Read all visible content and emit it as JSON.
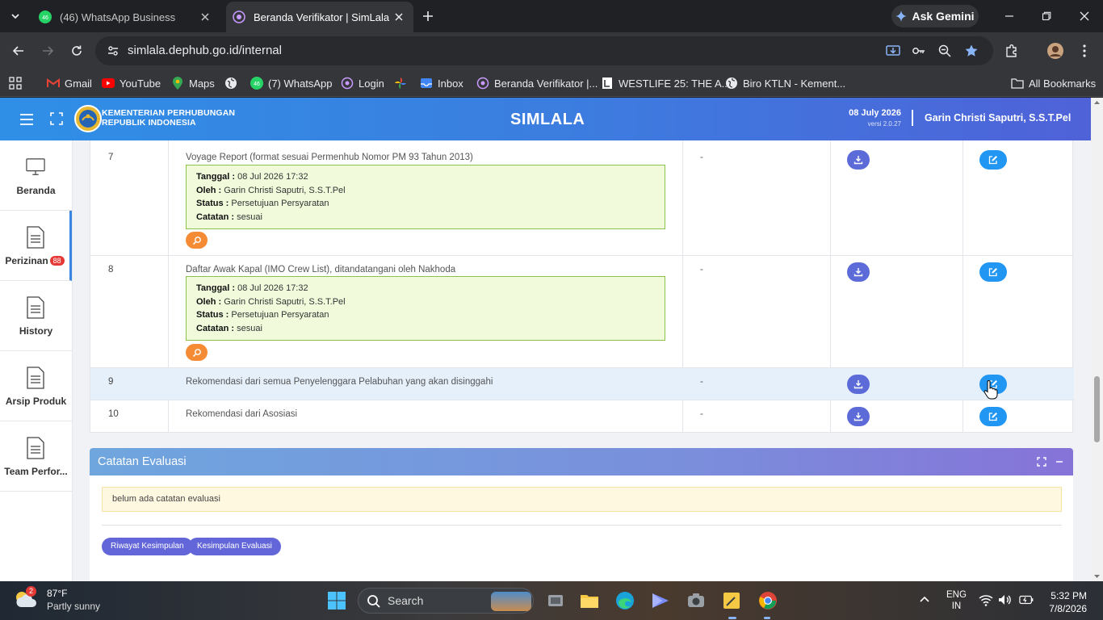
{
  "browser": {
    "tabs": [
      {
        "label": "(46) WhatsApp Business",
        "active": false
      },
      {
        "label": "Beranda Verifikator | SimLala",
        "active": true
      }
    ],
    "gemini_label": "Ask Gemini",
    "url": "simlala.dephub.go.id/internal",
    "bookmarks": [
      {
        "label": "Gmail",
        "icon": "gmail-icon"
      },
      {
        "label": "YouTube",
        "icon": "youtube-icon"
      },
      {
        "label": "Maps",
        "icon": "maps-icon"
      },
      {
        "label": "",
        "icon": "globe-icon"
      },
      {
        "label": "(7) WhatsApp",
        "icon": "whatsapp-icon"
      },
      {
        "label": "Login",
        "icon": "site-icon"
      },
      {
        "label": "",
        "icon": "photos-icon"
      },
      {
        "label": "Inbox",
        "icon": "inbox-icon"
      },
      {
        "label": "Beranda Verifikator |...",
        "icon": "site-icon"
      },
      {
        "label": "WESTLIFE 25: THE A...",
        "icon": "doc-icon"
      },
      {
        "label": "Biro KTLN - Kement...",
        "icon": "globe-icon"
      }
    ],
    "all_bookmarks": "All Bookmarks"
  },
  "header": {
    "org_line1": "KEMENTERIAN PERHUBUNGAN",
    "org_line2": "REPUBLIK INDONESIA",
    "app_title": "SIMLALA",
    "date": "08 July 2026",
    "version": "versi 2.0.27",
    "user": "Garin Christi Saputri, S.S.T.Pel"
  },
  "sidebar": {
    "items": [
      {
        "label": "Beranda",
        "icon": "monitor-icon"
      },
      {
        "label": "Perizinan",
        "icon": "document-icon",
        "badge": "88"
      },
      {
        "label": "History",
        "icon": "document-icon"
      },
      {
        "label": "Arsip Produk",
        "icon": "document-icon"
      },
      {
        "label": "Team Perfor...",
        "icon": "document-icon"
      }
    ]
  },
  "documents": {
    "rows": [
      {
        "no": "7",
        "name": "Voyage Report (format sesuai Permenhub Nomor PM 93 Tahun 2013)",
        "file": "-",
        "verification": {
          "tanggal_label": "Tanggal :",
          "tanggal": "08 Jul 2026 17:32",
          "oleh_label": "Oleh :",
          "oleh": "Garin Christi Saputri, S.S.T.Pel",
          "status_label": "Status :",
          "status": "Persetujuan Persyaratan",
          "catatan_label": "Catatan :",
          "catatan": "sesuai"
        }
      },
      {
        "no": "8",
        "name": "Daftar Awak Kapal (IMO Crew List), ditandatangani oleh Nakhoda",
        "file": "-",
        "verification": {
          "tanggal_label": "Tanggal :",
          "tanggal": "08 Jul 2026 17:32",
          "oleh_label": "Oleh :",
          "oleh": "Garin Christi Saputri, S.S.T.Pel",
          "status_label": "Status :",
          "status": "Persetujuan Persyaratan",
          "catatan_label": "Catatan :",
          "catatan": "sesuai"
        }
      },
      {
        "no": "9",
        "name": "Rekomendasi dari semua Penyelenggara Pelabuhan yang akan disinggahi",
        "file": "-"
      },
      {
        "no": "10",
        "name": "Rekomendasi dari Asosiasi",
        "file": "-"
      }
    ]
  },
  "evaluation": {
    "title": "Catatan Evaluasi",
    "empty_note": "belum ada catatan evaluasi",
    "btn_history": "Riwayat Kesimpulan",
    "btn_conclusion": "Kesimpulan Evaluasi"
  },
  "taskbar": {
    "weather_temp": "87°F",
    "weather_desc": "Partly sunny",
    "weather_badge": "2",
    "search_placeholder": "Search",
    "lang1": "ENG",
    "lang2": "IN",
    "time": "5:32 PM",
    "date": "7/8/2026"
  },
  "colors": {
    "header_gradient_start": "#2f8fe6",
    "header_gradient_end": "#4f62d8",
    "download_button": "#5c6bd8",
    "edit_button": "#2196f3",
    "search_button": "#f58c35",
    "verification_box": "#f1fbdc",
    "badge": "#e53935"
  }
}
